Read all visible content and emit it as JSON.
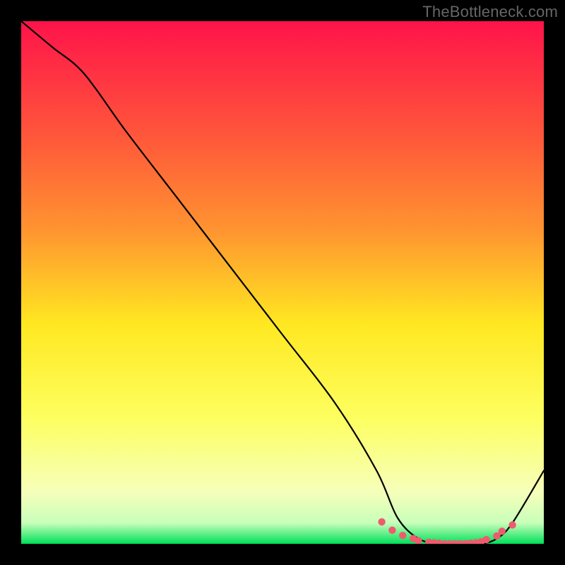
{
  "watermark": {
    "text": "TheBottleneck.com"
  },
  "chart_data": {
    "type": "line",
    "title": "",
    "xlabel": "",
    "ylabel": "",
    "xlim": [
      0,
      100
    ],
    "ylim": [
      0,
      100
    ],
    "series": [
      {
        "name": "bottleneck-curve",
        "x": [
          0,
          6,
          12,
          20,
          30,
          40,
          50,
          60,
          68,
          72,
          76,
          80,
          84,
          88,
          91,
          94,
          100
        ],
        "y": [
          100,
          95,
          90,
          79,
          66,
          53,
          40,
          27,
          14,
          5,
          1,
          0,
          0,
          0,
          1,
          4,
          14
        ]
      }
    ],
    "markers": [
      {
        "name": "lowest-bottleneck-dots",
        "x": [
          69,
          71,
          73,
          75,
          76,
          78,
          79,
          80,
          81,
          82,
          83,
          84,
          85,
          86,
          87,
          88,
          89,
          91,
          92,
          94
        ],
        "y": [
          4.2,
          2.6,
          1.6,
          1.0,
          0.6,
          0.3,
          0.2,
          0.1,
          0.0,
          0.0,
          0.0,
          0.0,
          0.0,
          0.1,
          0.2,
          0.4,
          0.8,
          1.5,
          2.4,
          3.6
        ]
      }
    ],
    "background_gradient": {
      "top": "#ff134a",
      "mid_upper": "#ff9430",
      "mid": "#ffe821",
      "low": "#fdff60",
      "pale": "#f6ffba",
      "bottom": "#00e05a"
    }
  }
}
